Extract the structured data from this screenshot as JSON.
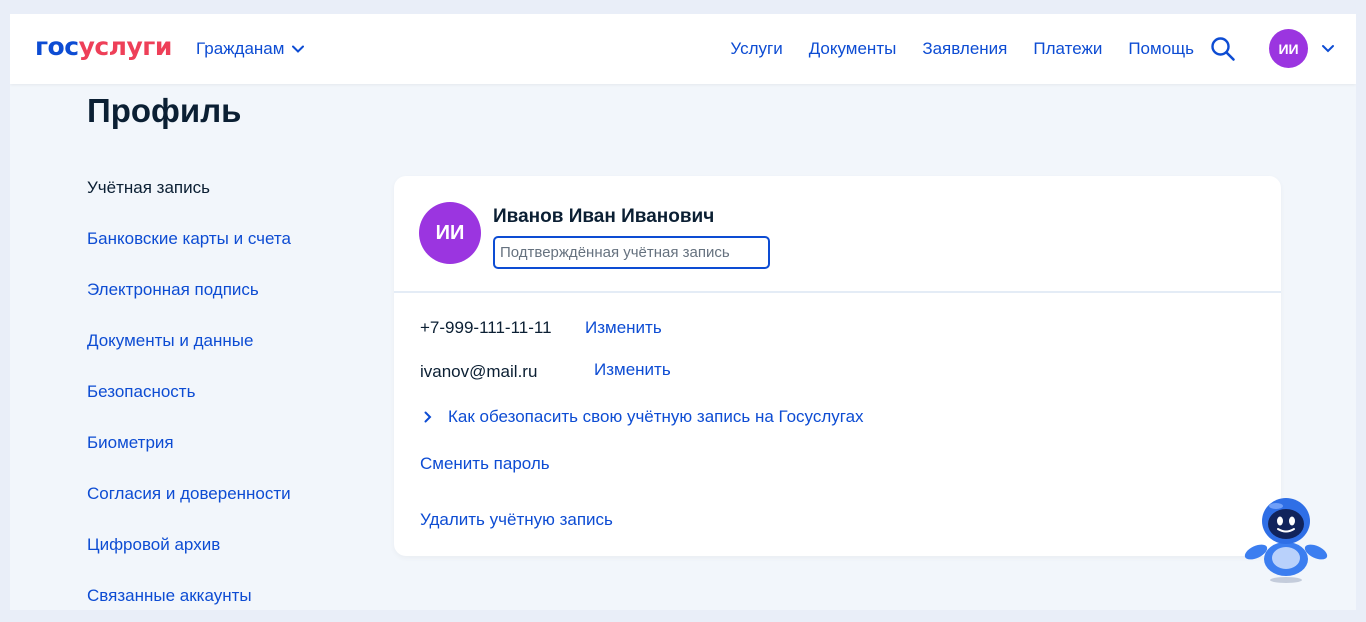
{
  "header": {
    "logo_part1": "гос",
    "logo_part2": "услуги",
    "audience": "Гражданам",
    "nav": [
      "Услуги",
      "Документы",
      "Заявления",
      "Платежи",
      "Помощь"
    ],
    "user_initials": "ИИ"
  },
  "page": {
    "title": "Профиль"
  },
  "sidebar": {
    "items": [
      "Учётная запись",
      "Банковские карты и счета",
      "Электронная подпись",
      "Документы и данные",
      "Безопасность",
      "Биометрия",
      "Согласия и доверенности",
      "Цифровой архив",
      "Связанные аккаунты"
    ]
  },
  "profile": {
    "initials": "ИИ",
    "full_name": "Иванов Иван Иванович",
    "status": "Подтверждённая учётная запись",
    "phone": "+7-999-111-11-11",
    "phone_action": "Изменить",
    "email": "ivanov@mail.ru",
    "email_action": "Изменить",
    "secure_hint": "Как обезопасить свою учётную запись на Госуслугах",
    "change_password": "Сменить пароль",
    "delete_account": "Удалить учётную запись"
  },
  "colors": {
    "brand_blue": "#0d4cd3",
    "brand_red": "#ee3f58",
    "avatar_purple": "#9b35e0",
    "text_dark": "#0b1f33",
    "background": "#f2f6fb"
  },
  "icons": {
    "search": "search-icon",
    "chevron": "chevron-down-icon",
    "assistant": "robot-assistant-icon"
  }
}
